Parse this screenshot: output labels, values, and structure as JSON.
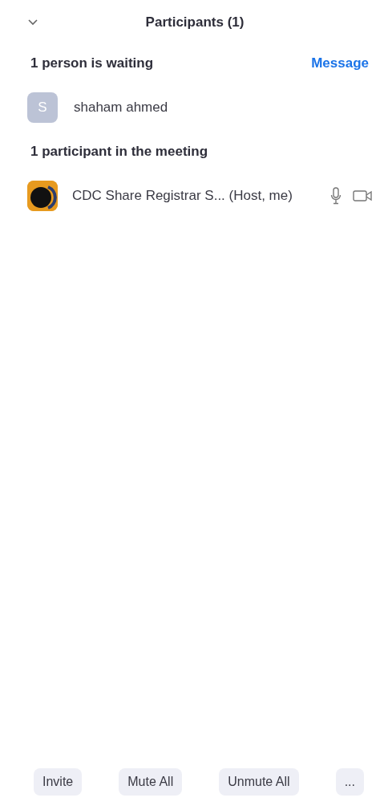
{
  "header": {
    "title": "Participants (1)"
  },
  "waiting": {
    "heading": "1 person is waiting",
    "action": "Message",
    "people": [
      {
        "initial": "S",
        "name": "shaham ahmed"
      }
    ]
  },
  "in_meeting": {
    "heading": "1 participant in the meeting",
    "people": [
      {
        "name": "CDC Share Registrar S... (Host, me)"
      }
    ]
  },
  "buttons": [
    {
      "label": "Invite"
    },
    {
      "label": "Mute All"
    },
    {
      "label": "Unmute All"
    },
    {
      "label": "..."
    }
  ]
}
